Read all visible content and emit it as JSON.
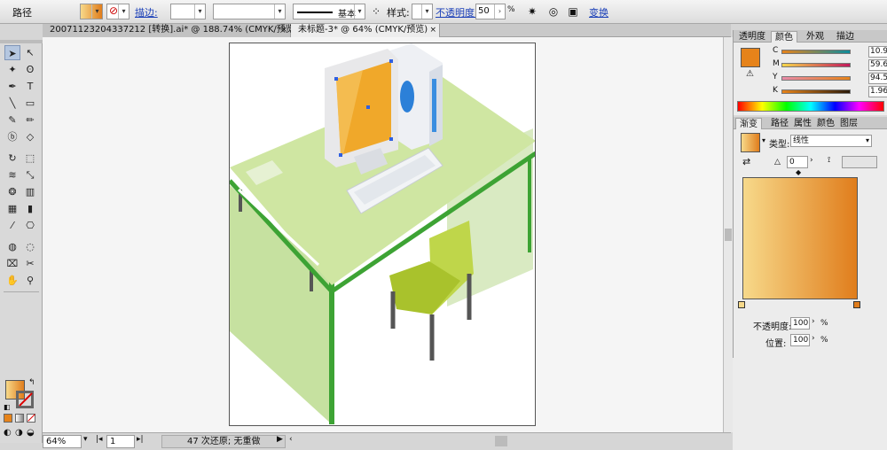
{
  "control_bar": {
    "object_type": "路径",
    "stroke_label": "描边:",
    "stroke_weight": "",
    "stroke_profile": "基本",
    "style_label": "样式:",
    "opacity_label": "不透明度:",
    "opacity_value": "50",
    "opacity_unit": "%",
    "transform_label": "变换"
  },
  "tabs": [
    {
      "label": "20071123204337212 [转换].ai* @ 188.74% (CMYK/预览)",
      "close": "×"
    },
    {
      "label": "未标题-3* @ 64% (CMYK/预览)",
      "close": "×"
    }
  ],
  "tools": [
    "selection",
    "direct-select",
    "magic-wand",
    "lasso",
    "pen",
    "type",
    "line",
    "rectangle",
    "paintbrush",
    "pencil",
    "blob-brush",
    "eraser",
    "rotate",
    "scale",
    "warp",
    "free-transform",
    "symbol-sprayer",
    "column-graph",
    "mesh",
    "gradient",
    "eyedropper",
    "blend",
    "live-paint-bucket",
    "live-paint-select",
    "slice",
    "scissors",
    "hand",
    "zoom"
  ],
  "panel_tabs_top": [
    "透明度",
    "颜色",
    "外观",
    "描边"
  ],
  "color_panel": {
    "channels": [
      {
        "letter": "C",
        "value": "10.98"
      },
      {
        "letter": "M",
        "value": "59.61"
      },
      {
        "letter": "Y",
        "value": "94.51"
      },
      {
        "letter": "K",
        "value": "1.96"
      }
    ],
    "unit": "%",
    "swatch_color": "#e6831a"
  },
  "panel_tabs_bottom": [
    "渐变",
    "路径",
    "属性",
    "颜色",
    "图层"
  ],
  "gradient_panel": {
    "type_label": "类型:",
    "type_value": "线性",
    "angle_value": "0",
    "stop_opacity_label": "不透明度:",
    "stop_opacity_value": "100",
    "location_label": "位置:",
    "location_value": "100",
    "unit": "%",
    "start_color": "#f7d98a",
    "end_color": "#e07d1c"
  },
  "status_bar": {
    "zoom": "64%",
    "artboard": "1",
    "undo_status": "47 次还原; 无重做"
  },
  "colors": {
    "desk_top": "#cfe6a2",
    "desk_edge": "#3da334",
    "screen_orange": "#f0a82a"
  }
}
